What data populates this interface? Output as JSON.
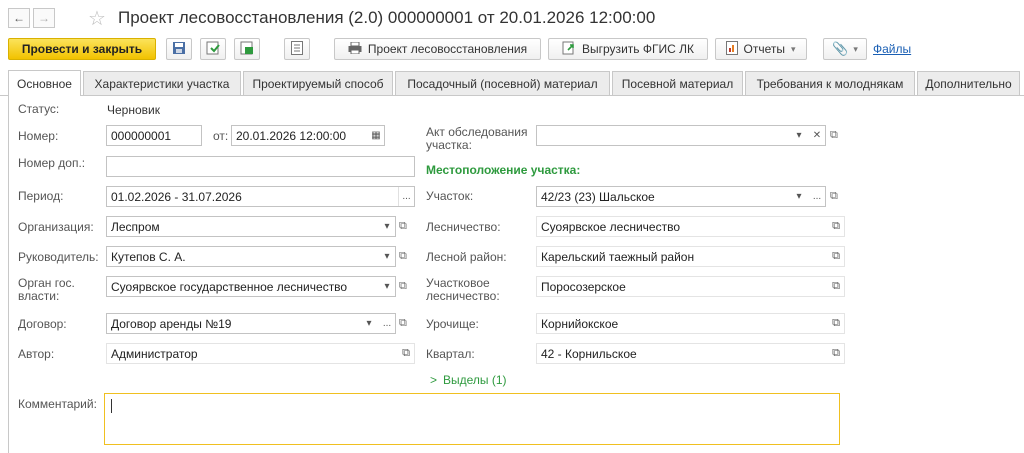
{
  "window": {
    "title": "Проект лесовосстановления (2.0) 000000001 от 20.01.2026 12:00:00",
    "back_glyph": "←",
    "forward_glyph": "→",
    "favorite_glyph": "☆"
  },
  "toolbar": {
    "post_close": "Провести и закрыть",
    "project": "Проект лесовосстановления",
    "export": "Выгрузить ФГИС ЛК",
    "reports": "Отчеты",
    "files": "Файлы"
  },
  "tabs": [
    "Основное",
    "Характеристики участка",
    "Проектируемый способ",
    "Посадочный (посевной) материал",
    "Посевной материал",
    "Требования к молоднякам",
    "Дополнительно"
  ],
  "form": {
    "status_label": "Статус:",
    "status_value": "Черновик",
    "number_label": "Номер:",
    "number_value": "000000001",
    "from_label": "от:",
    "date_value": "20.01.2026 12:00:00",
    "extra_number_label": "Номер доп.:",
    "extra_number_value": "",
    "period_label": "Период:",
    "period_value": "01.02.2026 - 31.07.2026",
    "org_label": "Организация:",
    "org_value": "Леспром",
    "head_label": "Руководитель:",
    "head_value": "Кутепов С. А.",
    "authority_label_1": "Орган гос.",
    "authority_label_2": "власти:",
    "authority_value": "Суоярвское государственное лесничество",
    "contract_label": "Договор:",
    "contract_value": "Договор аренды №19",
    "author_label": "Автор:",
    "author_value": "Администратор",
    "survey_label_1": "Акт обследования",
    "survey_label_2": "участка:",
    "survey_value": "",
    "location_header": "Местоположение участка:",
    "plot_label": "Участок:",
    "plot_value": "42/23 (23) Шальское",
    "forestry_label": "Лесничество:",
    "forestry_value": "Суоярвское лесничество",
    "forest_district_label": "Лесной район:",
    "forest_district_value": "Карельский таежный район",
    "local_forestry_label_1": "Участковое",
    "local_forestry_label_2": "лесничество:",
    "local_forestry_value": "Поросозерское",
    "tract_label": "Урочище:",
    "tract_value": "Корнийокское",
    "quarter_label": "Квартал:",
    "quarter_value": "42 - Корнильское",
    "allotments_link": "Выделы (1)",
    "comment_label": "Комментарий:",
    "comment_value": ""
  },
  "colors": {
    "accent_green": "#2e9a3e",
    "primary_yellow": "#f5c800",
    "link_blue": "#1a5fb4",
    "focus_border": "#f0c020"
  }
}
